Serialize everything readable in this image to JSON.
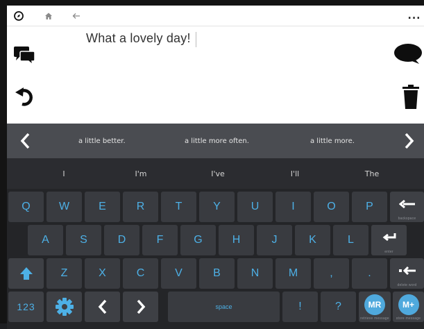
{
  "topbar": {
    "icons": [
      "compass-icon",
      "home-icon",
      "back-arrow-icon",
      "more-icon"
    ],
    "more_label": "..."
  },
  "compose": {
    "message": "What a lovely day!"
  },
  "predictions": {
    "phrases": [
      "a little better.",
      "a little more often.",
      "a little more."
    ]
  },
  "word_suggestions": [
    "I",
    "I'm",
    "I've",
    "I'll",
    "The"
  ],
  "keyboard": {
    "row1": [
      "Q",
      "W",
      "E",
      "R",
      "T",
      "Y",
      "U",
      "I",
      "O",
      "P"
    ],
    "row2": [
      "A",
      "S",
      "D",
      "F",
      "G",
      "H",
      "J",
      "K",
      "L"
    ],
    "row3": [
      "Z",
      "X",
      "C",
      "V",
      "B",
      "N",
      "M",
      ",",
      "."
    ],
    "backspace_label": "backspace",
    "enter_label": "enter",
    "delete_word_label": "delete word",
    "numbers_label": "123",
    "space_label": "space",
    "exclaim_label": "!",
    "question_label": "?",
    "mr_label": "MR",
    "mr_sub": "retrieve message",
    "mplus_label": "M+",
    "mplus_sub": "store message"
  },
  "colors": {
    "accent": "#4db0e6",
    "key_bg": "#393b40",
    "prediction_bar": "#4a4c51"
  }
}
